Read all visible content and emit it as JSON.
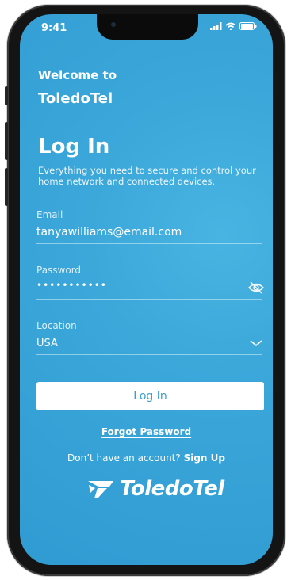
{
  "status_bar": {
    "time": "9:41"
  },
  "header": {
    "welcome": "Welcome to",
    "brand": "ToledoTel"
  },
  "login": {
    "title": "Log In",
    "subtitle": "Everything you need to secure and control your home network and connected devices.",
    "email_label": "Email",
    "email_value": "tanyawilliams@email.com",
    "password_label": "Password",
    "password_value": "•••••••••••",
    "location_label": "Location",
    "location_value": "USA",
    "submit_label": "Log In",
    "forgot_label": "Forgot Password",
    "no_account_text": "Don’t have an account?",
    "signup_label": "Sign Up"
  },
  "logo": {
    "text": "ToledoTel"
  },
  "colors": {
    "background": "#3aa6d9",
    "button_text": "#3a9fd4"
  },
  "icons": [
    "signal-icon",
    "wifi-icon",
    "battery-icon",
    "eye-slash-icon",
    "chevron-down-icon",
    "logo-mark-icon"
  ]
}
